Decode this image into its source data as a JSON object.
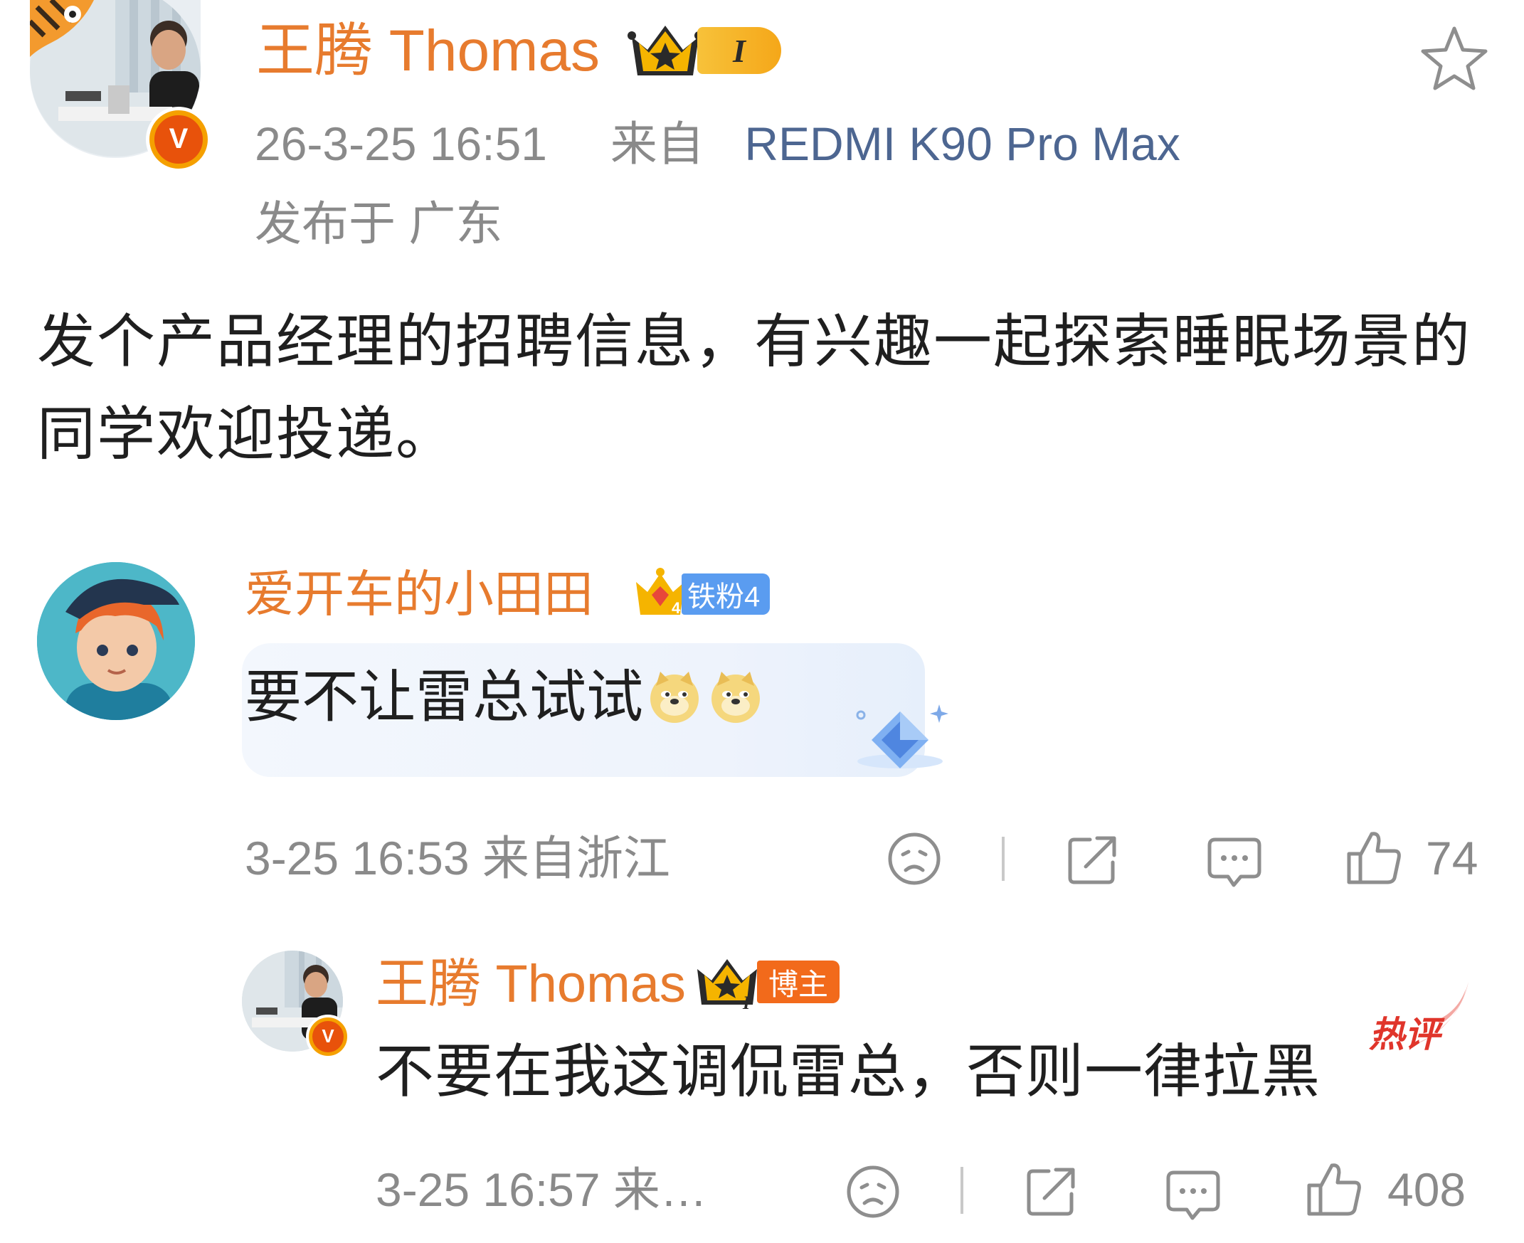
{
  "post": {
    "author": "王腾 Thomas",
    "level_badge": "I",
    "timestamp": "26-3-25 16:51",
    "source_prefix": "来自",
    "device": "REDMI K90 Pro Max",
    "location": "发布于 广东",
    "content": "发个产品经理的招聘信息，有兴趣一起探索睡眠场景的同学欢迎投递。",
    "verified_badge": "V",
    "favorite_icon": "star-outline-icon"
  },
  "comment": {
    "author": "爱开车的小田田",
    "fan_badge": "铁粉4",
    "fan_level": "4",
    "text": "要不让雷总试试",
    "emoji": "doge-emoji",
    "time_location": "3-25 16:53 来自浙江",
    "like_count": "74"
  },
  "reply": {
    "author": "王腾 Thomas",
    "role_badge": "博主",
    "level_badge": "I",
    "verified_badge": "V",
    "hot_label": "热评",
    "text": "不要在我这调侃雷总，否则一律拉黑",
    "time_location": "3-25 16:57 来…",
    "like_count": "408"
  },
  "colors": {
    "name": "#e77b2e",
    "meta": "#8a8a8a",
    "device": "#4d6691",
    "hot": "#e0352b",
    "fan_badge": "#5a9cf0",
    "role_badge": "#f26a1b"
  }
}
